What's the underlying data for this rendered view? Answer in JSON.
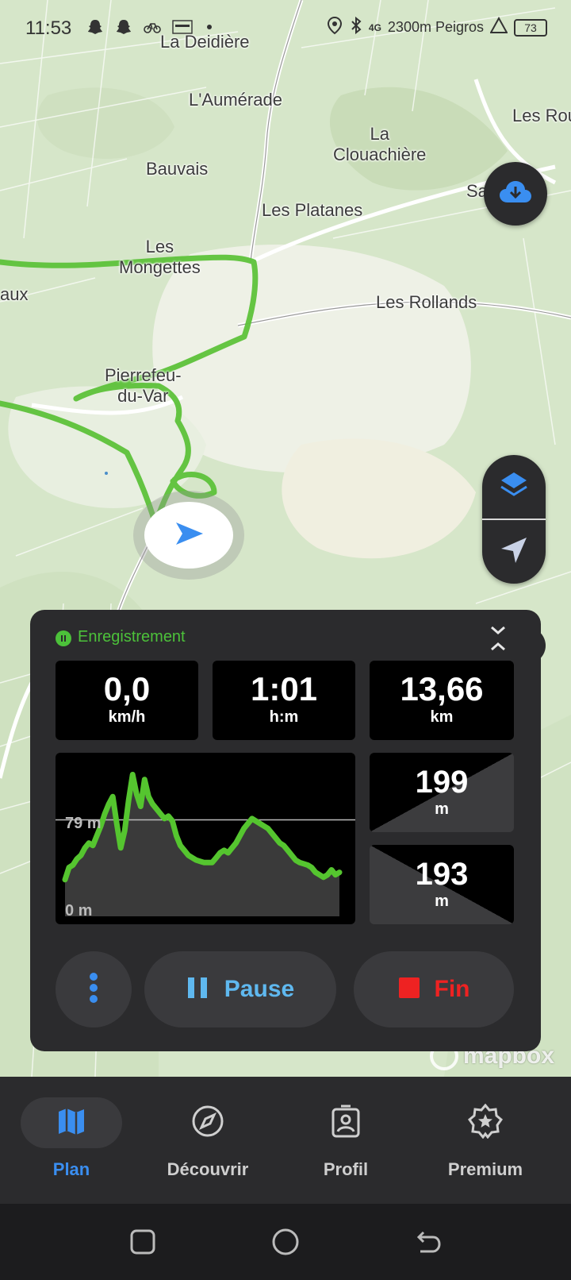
{
  "status_bar": {
    "time": "11:53",
    "right_text": "2300m Peigros",
    "network": "4G",
    "battery": "73"
  },
  "map": {
    "places": [
      "La Deidière",
      "L'Aumérade",
      "La\nClouachière",
      "Les Rou",
      "Bauvais",
      "Les Platanes",
      "Sa        n",
      "Les\nMongettes",
      "aux",
      "Les Rollands",
      "Pierrefeu-\ndu-Var"
    ],
    "attribution": "mapbox"
  },
  "recording": {
    "status_label": "Enregistrement",
    "speed": {
      "value": "0,0",
      "unit": "km/h"
    },
    "duration": {
      "value": "1:01",
      "unit": "h:m"
    },
    "distance": {
      "value": "13,66",
      "unit": "km"
    },
    "ascent": {
      "value": "199",
      "unit": "m"
    },
    "descent": {
      "value": "193",
      "unit": "m"
    },
    "chart_labels": {
      "ref": "79 m",
      "zero": "0 m"
    },
    "buttons": {
      "pause": "Pause",
      "end": "Fin"
    }
  },
  "chart_data": {
    "type": "area",
    "title": "",
    "xlabel": "",
    "ylabel": "",
    "ylim": [
      0,
      130
    ],
    "reference_line": 79,
    "tick_labels": [
      "79 m",
      "0 m"
    ],
    "series": [
      {
        "values": [
          30,
          40,
          42,
          47,
          50,
          56,
          60,
          58,
          66,
          74,
          84,
          92,
          98,
          76,
          56,
          70,
          95,
          116,
          100,
          90,
          112,
          98,
          92,
          88,
          84,
          80,
          82,
          78,
          66,
          58,
          54,
          50,
          48,
          46,
          45,
          44,
          44,
          44,
          48,
          52,
          54,
          52,
          56,
          60,
          66,
          72,
          76,
          80,
          78,
          76,
          74,
          72,
          68,
          64,
          60,
          58,
          54,
          50,
          46,
          44,
          43,
          42,
          40,
          36,
          34,
          32,
          34,
          38,
          34,
          36
        ]
      }
    ],
    "colors": {
      "line": "#55c52f",
      "fill": "#3a3a3a"
    }
  },
  "bottom_nav": {
    "tabs": [
      {
        "label": "Plan",
        "icon": "map-icon"
      },
      {
        "label": "Découvrir",
        "icon": "compass-icon"
      },
      {
        "label": "Profil",
        "icon": "profile-icon"
      },
      {
        "label": "Premium",
        "icon": "premium-badge-icon"
      }
    ]
  },
  "colors": {
    "accent_blue": "#3a8ef0",
    "record_green": "#4cc13a",
    "end_red": "#ee2222",
    "panel_bg": "#2b2b2d"
  }
}
